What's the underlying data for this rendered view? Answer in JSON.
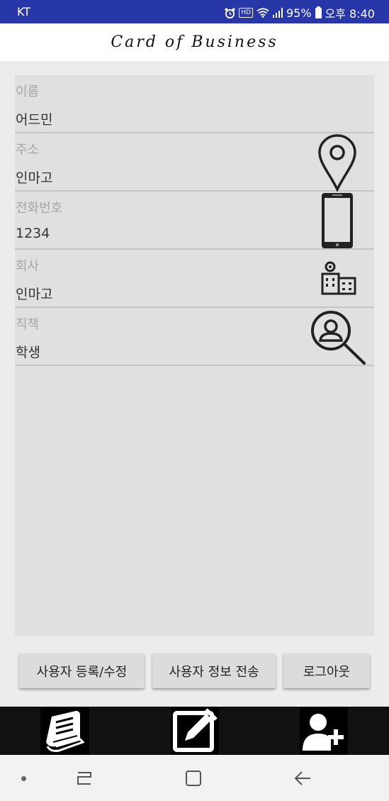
{
  "status_bar": {
    "carrier": "KT",
    "battery": "95%",
    "time": "오후 8:40",
    "hd_badge": "HD",
    "icons": [
      "alarm-icon",
      "hd-icon",
      "wifi-icon",
      "signal-icon",
      "battery-icon"
    ]
  },
  "header": {
    "title": "Card of Business"
  },
  "fields": [
    {
      "label": "이름",
      "value": "어드민",
      "icon": ""
    },
    {
      "label": "주소",
      "value": "인마고",
      "icon": "location-pin-icon"
    },
    {
      "label": "전화번호",
      "value": "1234",
      "icon": "smartphone-icon"
    },
    {
      "label": "회사",
      "value": "인마고",
      "icon": "building-icon"
    },
    {
      "label": "직책",
      "value": "학생",
      "icon": "user-search-icon"
    }
  ],
  "buttons": {
    "register_label": "사용자 등록/수정",
    "send_label": "사용자 정보 전송",
    "logout_label": "로그아웃"
  },
  "bottom_nav": [
    "book-icon",
    "edit-icon",
    "add-user-icon"
  ],
  "system_nav": [
    "dot-icon",
    "recent-apps-icon",
    "home-icon",
    "back-icon"
  ],
  "colors": {
    "status_bar": "#2837a8",
    "card_background": "#e0e0e0",
    "button": "#dcdcdc",
    "bottom_nav": "#000000"
  }
}
